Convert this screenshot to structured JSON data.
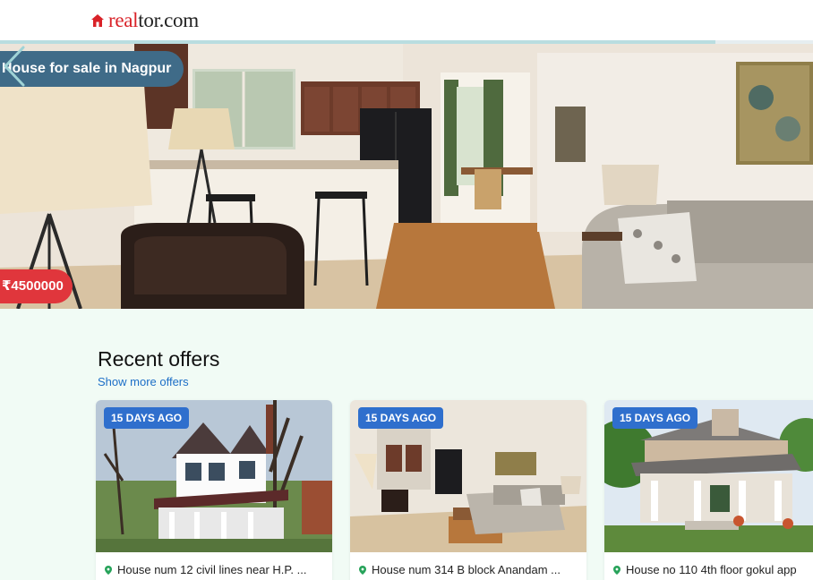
{
  "header": {
    "logo_text_red": "real",
    "logo_text_dark": "tor.com",
    "logo_icon": "home-icon"
  },
  "slider_progress": 0.88,
  "hero": {
    "title": "House for sale in Nagpur",
    "price": "₹4500000",
    "prev_icon": "chevron-left-icon"
  },
  "recent": {
    "title": "Recent offers",
    "show_more": "Show more offers"
  },
  "cards": [
    {
      "badge": "15 DAYS AGO",
      "caption": "House num 12 civil lines near H.P. ...",
      "pin_icon": "location-pin-icon"
    },
    {
      "badge": "15 DAYS AGO",
      "caption": "House num 314 B block Anandam ...",
      "pin_icon": "location-pin-icon"
    },
    {
      "badge": "15 DAYS AGO",
      "caption": "House no 110 4th floor gokul app",
      "pin_icon": "location-pin-icon"
    }
  ],
  "colors": {
    "brand_red": "#d92228",
    "title_banner": "#3f6b88",
    "price_banner": "#e0363c",
    "badge_blue": "#2f6fcd",
    "link_blue": "#1d6fc7",
    "page_bg": "#f1fbf5"
  }
}
